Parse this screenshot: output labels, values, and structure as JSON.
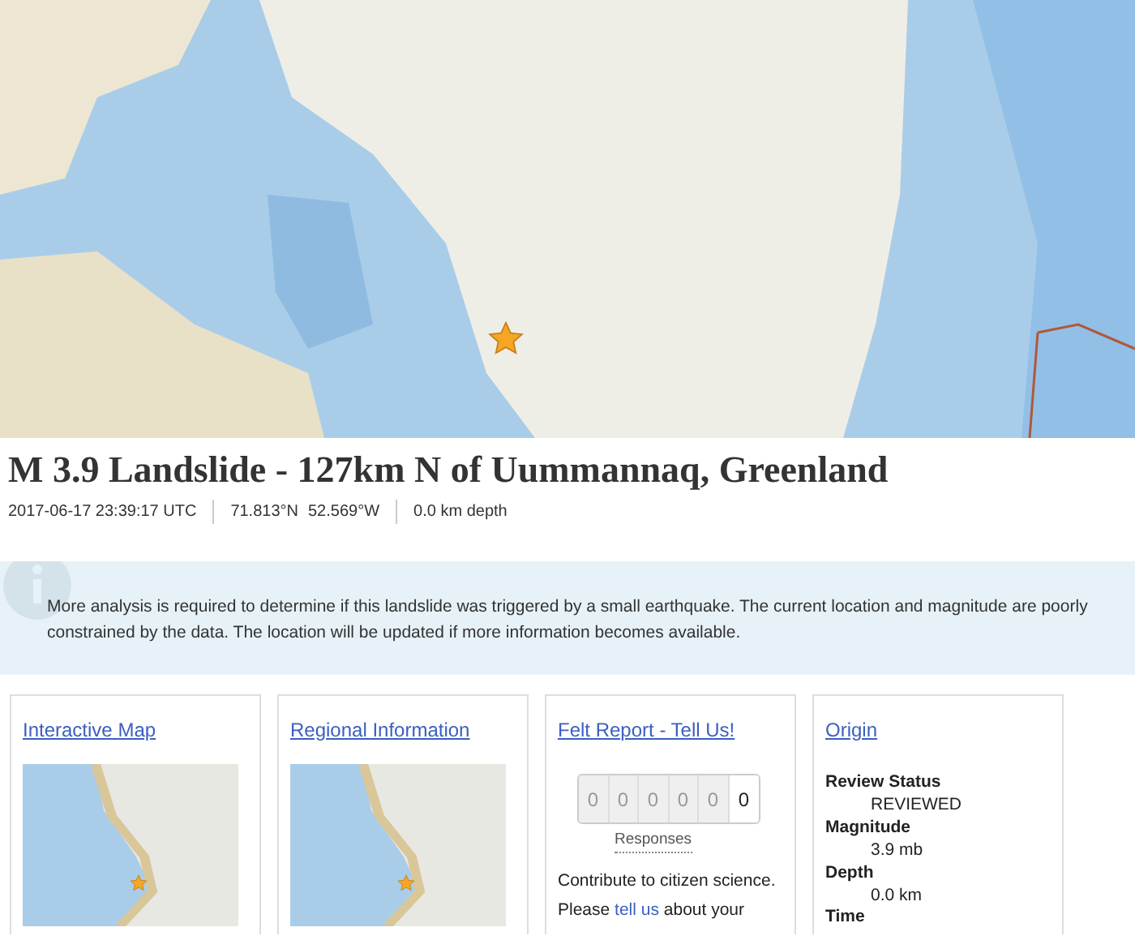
{
  "event": {
    "title": "M 3.9 Landslide - 127km N of Uummannaq, Greenland",
    "time": "2017-06-17 23:39:17 UTC",
    "latitude": "71.813°N",
    "longitude": "52.569°W",
    "depth": "0.0 km depth"
  },
  "notice": "More analysis is required to determine if this landslide was triggered by a small earthquake. The current location and magnitude are poorly constrained by the data. The location will be updated if more information becomes available.",
  "cards": [
    {
      "kind": "map",
      "title": "Interactive Map"
    },
    {
      "kind": "map",
      "title": "Regional Information"
    },
    {
      "kind": "felt",
      "title": "Felt Report - Tell Us!",
      "digits": [
        {
          "digit": "0",
          "filled": false
        },
        {
          "digit": "0",
          "filled": false
        },
        {
          "digit": "0",
          "filled": false
        },
        {
          "digit": "0",
          "filled": false
        },
        {
          "digit": "0",
          "filled": false
        },
        {
          "digit": "0",
          "filled": true
        }
      ],
      "caption": "Responses",
      "text": "Contribute to citizen science.",
      "prompt_before": "Please",
      "prompt_link": "tell us",
      "prompt_after": "about your"
    },
    {
      "kind": "origin",
      "title": "Origin",
      "fields": [
        {
          "label": "Review Status",
          "value": "REVIEWED"
        },
        {
          "label": "Magnitude",
          "value": "3.9 mb"
        },
        {
          "label": "Depth",
          "value": "0.0 km"
        }
      ],
      "next_label": "Time"
    }
  ]
}
